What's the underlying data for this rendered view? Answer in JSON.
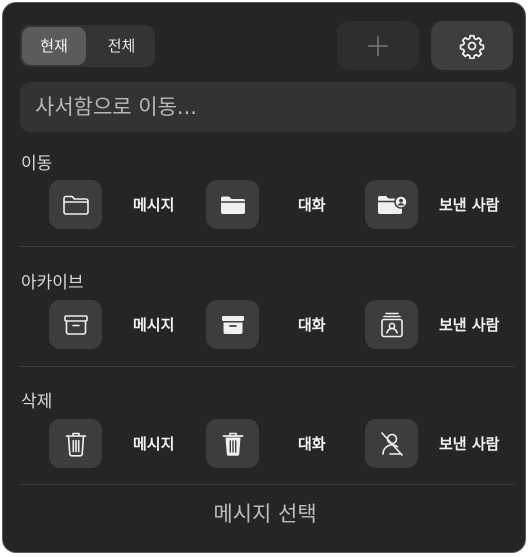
{
  "segmented": {
    "current_label": "현재",
    "all_label": "전체"
  },
  "toolbar": {
    "add_icon": "plus-icon",
    "settings_icon": "gear-icon"
  },
  "search": {
    "placeholder": "사서함으로 이동..."
  },
  "sections": {
    "move": {
      "title": "이동",
      "items": [
        {
          "label": "메시지",
          "icon": "folder-outline-icon"
        },
        {
          "label": "대화",
          "icon": "folder-filled-icon"
        },
        {
          "label": "보낸 사람",
          "icon": "folder-person-icon"
        }
      ]
    },
    "archive": {
      "title": "아카이브",
      "items": [
        {
          "label": "메시지",
          "icon": "archive-box-outline-icon"
        },
        {
          "label": "대화",
          "icon": "archive-box-filled-icon"
        },
        {
          "label": "보낸 사람",
          "icon": "archive-person-icon"
        }
      ]
    },
    "delete": {
      "title": "삭제",
      "items": [
        {
          "label": "메시지",
          "icon": "trash-outline-icon"
        },
        {
          "label": "대화",
          "icon": "trash-filled-icon"
        },
        {
          "label": "보낸 사람",
          "icon": "person-slash-icon"
        }
      ]
    }
  },
  "footer": {
    "select_messages_label": "메시지 선택"
  }
}
